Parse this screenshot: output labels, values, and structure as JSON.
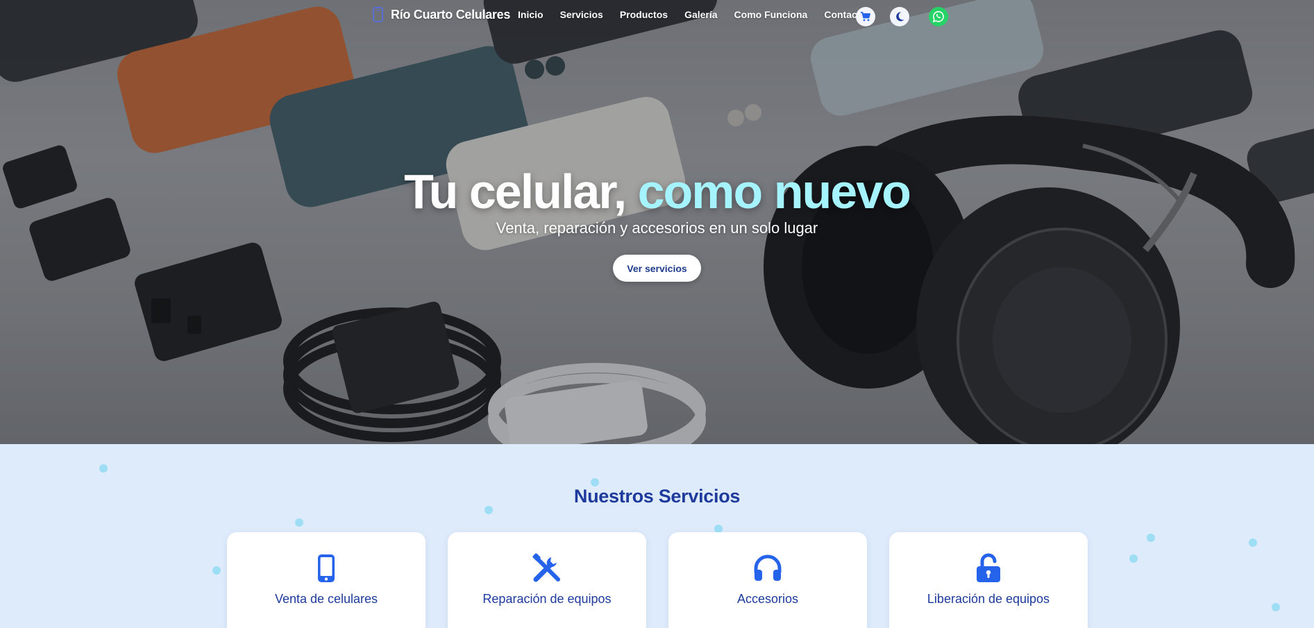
{
  "nav": {
    "brand": "Río Cuarto Celulares",
    "links": [
      "Inicio",
      "Servicios",
      "Productos",
      "Galería",
      "Como Funciona",
      "Contacto"
    ],
    "icons": {
      "cart": "cart-icon",
      "theme": "moon-icon",
      "whatsapp": "whatsapp-icon"
    }
  },
  "hero": {
    "title_part1": "Tu celular,",
    "title_accent": "como nuevo",
    "subtitle": "Venta, reparación y accesorios en un solo lugar",
    "cta": "Ver servicios"
  },
  "services": {
    "title": "Nuestros Servicios",
    "cards": [
      {
        "label": "Venta de celulares",
        "icon": "mobile-phone-icon"
      },
      {
        "label": "Reparación de equipos",
        "icon": "tools-icon"
      },
      {
        "label": "Accesorios",
        "icon": "headphones-icon"
      },
      {
        "label": "Liberación de equipos",
        "icon": "unlock-icon"
      }
    ]
  },
  "colors": {
    "accent_blue": "#2563eb",
    "title_blue": "#1e3a9c",
    "hero_accent": "#a5f3fc",
    "section_bg": "#deebfb",
    "whatsapp": "#25d366"
  }
}
